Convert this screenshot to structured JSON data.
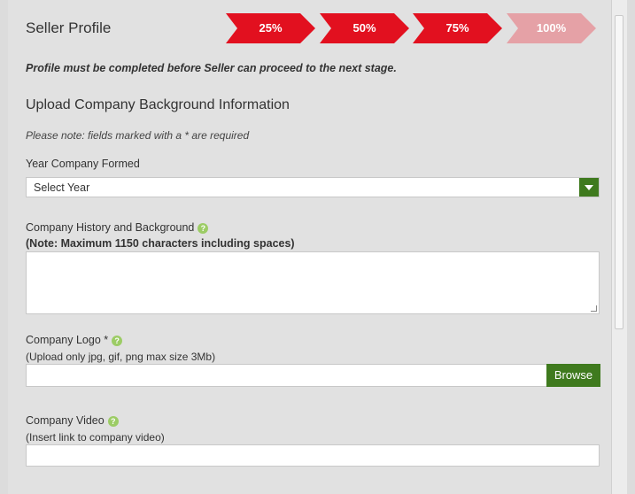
{
  "header": {
    "title": "Seller Profile",
    "steps": [
      {
        "label": "25%",
        "color": "#e2101f"
      },
      {
        "label": "50%",
        "color": "#e2101f"
      },
      {
        "label": "75%",
        "color": "#e2101f"
      },
      {
        "label": "100%",
        "color": "#e5a1a6"
      }
    ]
  },
  "notice": "Profile must be completed before Seller can proceed to the next stage.",
  "section": {
    "heading": "Upload Company Background Information",
    "required_note": "Please note: fields marked with a * are required"
  },
  "fields": {
    "year": {
      "label": "Year Company Formed",
      "value": "Select Year"
    },
    "history": {
      "label": "Company History and Background",
      "note": "(Note: Maximum 1150 characters including spaces)",
      "help_icon": "help-icon"
    },
    "logo": {
      "label": "Company Logo *",
      "note": "(Upload only jpg, gif, png max size 3Mb)",
      "browse_label": "Browse",
      "help_icon": "help-icon"
    },
    "video": {
      "label": "Company Video",
      "note": "(Insert link to company video)",
      "help_icon": "help-icon"
    }
  },
  "colors": {
    "accent_green": "#3f7a1e",
    "help_green": "#9ccc65"
  }
}
